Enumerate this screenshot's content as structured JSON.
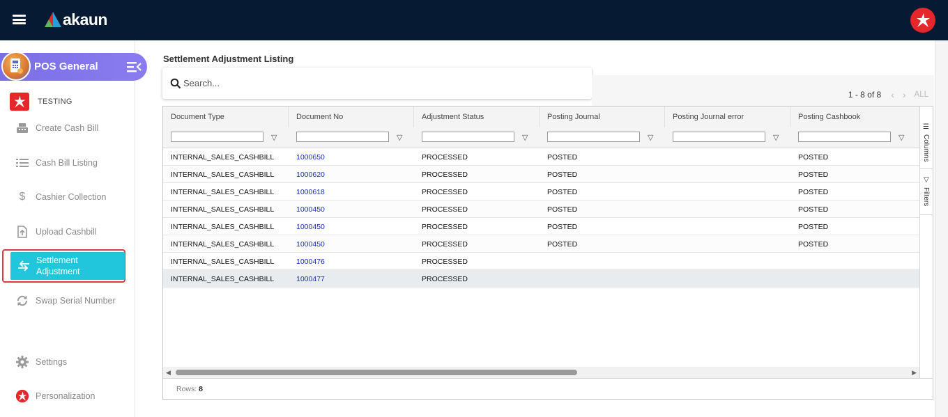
{
  "header": {
    "brand": "akaun"
  },
  "sidebar": {
    "app_title": "POS General",
    "org_name": "TESTING",
    "items": [
      {
        "label": "Create Cash Bill",
        "icon": "cash-register-icon"
      },
      {
        "label": "Cash Bill Listing",
        "icon": "list-icon"
      },
      {
        "label": "Cashier Collection",
        "icon": "dollar-icon"
      },
      {
        "label": "Upload Cashbill",
        "icon": "upload-file-icon"
      },
      {
        "label": "Settlement Adjustment",
        "icon": "swap-arrows-icon",
        "active": true
      },
      {
        "label": "Swap Serial Number",
        "icon": "sync-icon"
      }
    ],
    "settings_label": "Settings",
    "personalization_label": "Personalization"
  },
  "main": {
    "page_title": "Settlement Adjustment Listing",
    "search_placeholder": "Search...",
    "pager": {
      "range": "1 - 8 of 8",
      "all_label": "ALL"
    },
    "columns": [
      "Document Type",
      "Document No",
      "Adjustment Status",
      "Posting Journal",
      "Posting Journal error",
      "Posting Cashbook"
    ],
    "rows": [
      [
        "INTERNAL_SALES_CASHBILL",
        "1000650",
        "PROCESSED",
        "POSTED",
        "",
        "POSTED"
      ],
      [
        "INTERNAL_SALES_CASHBILL",
        "1000620",
        "PROCESSED",
        "POSTED",
        "",
        "POSTED"
      ],
      [
        "INTERNAL_SALES_CASHBILL",
        "1000618",
        "PROCESSED",
        "POSTED",
        "",
        "POSTED"
      ],
      [
        "INTERNAL_SALES_CASHBILL",
        "1000450",
        "PROCESSED",
        "POSTED",
        "",
        "POSTED"
      ],
      [
        "INTERNAL_SALES_CASHBILL",
        "1000450",
        "PROCESSED",
        "POSTED",
        "",
        "POSTED"
      ],
      [
        "INTERNAL_SALES_CASHBILL",
        "1000450",
        "PROCESSED",
        "POSTED",
        "",
        "POSTED"
      ],
      [
        "INTERNAL_SALES_CASHBILL",
        "1000476",
        "PROCESSED",
        "",
        "",
        ""
      ],
      [
        "INTERNAL_SALES_CASHBILL",
        "1000477",
        "PROCESSED",
        "",
        "",
        ""
      ]
    ],
    "side_tabs": {
      "columns": "Columns",
      "filters": "Filters"
    },
    "footer": {
      "rows_label": "Rows:",
      "rows_count": "8"
    }
  },
  "colors": {
    "topbar": "#061a33",
    "app_pill": "#7b6fe6",
    "active_item": "#22c6dc",
    "highlight_border": "#e0383c",
    "link": "#1a2fb8",
    "brand_red": "#e5262b"
  }
}
